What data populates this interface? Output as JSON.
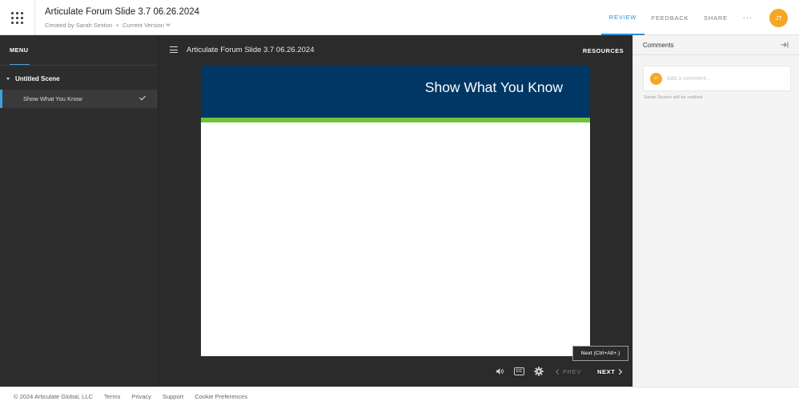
{
  "header": {
    "title": "Articulate Forum Slide 3.7 06.26.2024",
    "created_by": "Created by Sarah Sexton",
    "separator": "•",
    "version": "Current Version",
    "tabs": [
      {
        "label": "REVIEW",
        "active": true
      },
      {
        "label": "FEEDBACK",
        "active": false
      },
      {
        "label": "SHARE",
        "active": false
      },
      {
        "label": "···",
        "active": false
      }
    ],
    "user_initials": "JT",
    "accent_color": "#2d8fd6",
    "avatar_color": "#f5a623"
  },
  "menu": {
    "tab_label": "MENU",
    "scene_title": "Untitled Scene",
    "items": [
      {
        "label": "Show What You Know",
        "completed": true,
        "icon": "check-icon"
      }
    ]
  },
  "player": {
    "course_title": "Articulate Forum Slide 3.7 06.26.2024",
    "resources_label": "RESOURCES",
    "slide": {
      "heading": "Show What You Know",
      "header_color": "#003764",
      "stripe_color": "#6fc33a"
    },
    "tooltip": "Next (Ctrl+Alt+.)",
    "controls": {
      "cc_label": "CC",
      "prev_label": "PREV",
      "next_label": "NEXT"
    }
  },
  "comments": {
    "title": "Comments",
    "avatar_initials": "JT",
    "placeholder": "Add a comment...",
    "notify_text": "Sarah Sexton will be notified"
  },
  "footer": {
    "copyright": "© 2024 Articulate Global, LLC",
    "links": [
      "Terms",
      "Privacy",
      "Support",
      "Cookie Preferences"
    ]
  }
}
